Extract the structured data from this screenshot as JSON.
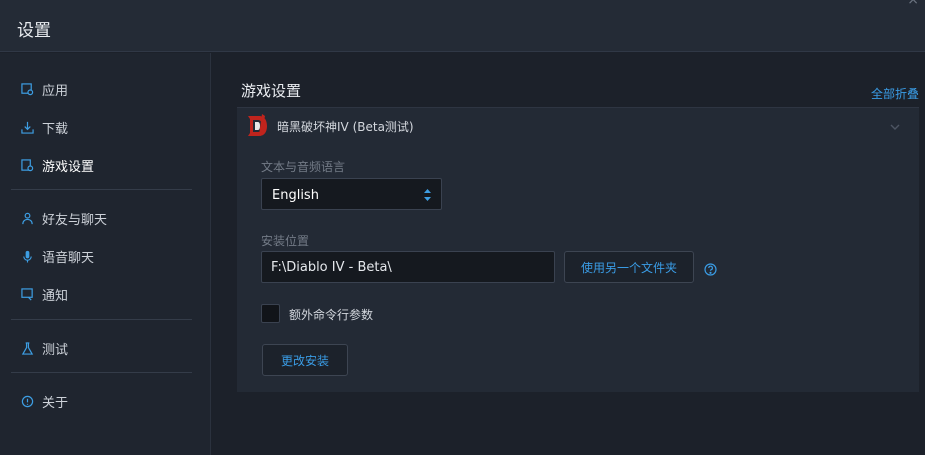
{
  "window": {
    "title": "设置",
    "close_glyph": "×"
  },
  "sidebar": {
    "items": [
      {
        "label": "应用",
        "icon": "app-gear-icon"
      },
      {
        "label": "下载",
        "icon": "download-icon"
      },
      {
        "label": "游戏设置",
        "icon": "game-settings-icon",
        "active": true
      },
      {
        "label": "好友与聊天",
        "icon": "friends-icon"
      },
      {
        "label": "语音聊天",
        "icon": "microphone-icon"
      },
      {
        "label": "通知",
        "icon": "notification-icon"
      },
      {
        "label": "测试",
        "icon": "flask-icon"
      },
      {
        "label": "关于",
        "icon": "info-icon"
      }
    ]
  },
  "main": {
    "section_title": "游戏设置",
    "collapse_all": "全部折叠",
    "game": {
      "name": "暗黑破坏神IV (Beta测试)",
      "logo_icon": "diablo-logo-icon",
      "language": {
        "label": "文本与音频语言",
        "selected": "English"
      },
      "install": {
        "label": "安装位置",
        "path": "F:\\Diablo IV - Beta\\",
        "browse_button": "使用另一个文件夹",
        "help_icon": "help-icon"
      },
      "extra_args": {
        "label": "额外命令行参数",
        "checked": false
      },
      "change_install_button": "更改安装"
    }
  },
  "colors": {
    "accent": "#3a9ce5",
    "background": "#1c212a",
    "panel": "#232a35",
    "titlebar": "#242b36",
    "logo_red": "#c0241d"
  }
}
